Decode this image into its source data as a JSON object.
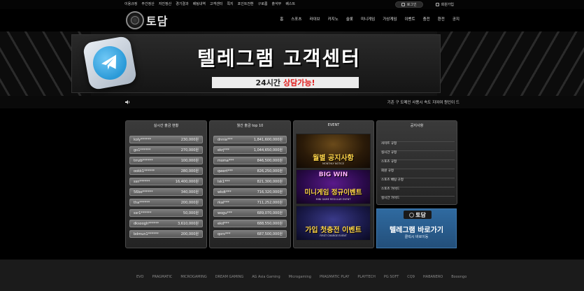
{
  "topbar": {
    "links": [
      "이용규정",
      "주간정산",
      "자진정산",
      "경기결과",
      "베팅내역",
      "고객센터",
      "쪽지",
      "포인트전환",
      "구로롬",
      "출석부",
      "퀘스트"
    ],
    "login_label": "로그인",
    "signup_label": "회원가입"
  },
  "header": {
    "logo_text": "토담",
    "nav": [
      "홈",
      "스포츠",
      "라이브",
      "카지노",
      "슬롯",
      "미니게임",
      "가상게임",
      "이벤트",
      "충전",
      "환전",
      "공지"
    ]
  },
  "banner": {
    "title": "텔레그램 고객센터",
    "sub_a": "24시간",
    "sub_b": "상담가능!"
  },
  "ticker": {
    "text": "기존 구 도메인 사용시 속도 지여여 원인이 드"
  },
  "withdraw_panel": {
    "title": "실시간 출금 현황",
    "rows": [
      {
        "user": "koly******",
        "amount": "230,000원"
      },
      {
        "user": "go1******",
        "amount": "270,000원"
      },
      {
        "user": "tmzb******",
        "amount": "100,000원"
      },
      {
        "user": "ookk1******",
        "amount": "280,000원"
      },
      {
        "user": "ssn******",
        "amount": "16,400,000원"
      },
      {
        "user": "56bo******",
        "amount": "340,000원"
      },
      {
        "user": "tha******",
        "amount": "200,000원"
      },
      {
        "user": "ssr1******",
        "amount": "50,000원"
      },
      {
        "user": "dksoogh******",
        "amount": "3,610,000원"
      },
      {
        "user": "bdmun1******",
        "amount": "200,000원"
      }
    ]
  },
  "top10_panel": {
    "title": "월간 출금 top 10",
    "rows": [
      {
        "user": "dnnia***",
        "amount": "1,841,600,000원"
      },
      {
        "user": "ekrj***",
        "amount": "1,044,650,000원"
      },
      {
        "user": "moma***",
        "amount": "846,500,000원"
      },
      {
        "user": "qwert***",
        "amount": "826,250,000원"
      },
      {
        "user": "lsk1***",
        "amount": "821,300,000원"
      },
      {
        "user": "wkdt***",
        "amount": "716,320,000원"
      },
      {
        "user": "rkal***",
        "amount": "711,252,000원"
      },
      {
        "user": "wogu***",
        "amount": "689,070,000원"
      },
      {
        "user": "ekd***",
        "amount": "688,550,000원"
      },
      {
        "user": "qors***",
        "amount": "687,500,000원"
      }
    ]
  },
  "event_panel": {
    "title": "EVENT",
    "events": [
      {
        "title": "월별 공지사항",
        "sub": "MONTHLY NOTICE"
      },
      {
        "title": "미니게임 정규이벤트",
        "sub": "MINI GAME REGULAR EVENT",
        "badge": "BIG WIN"
      },
      {
        "title": "가입 첫충전 이벤트",
        "sub": "FIRST CHARGE EVENT"
      }
    ]
  },
  "notice_panel": {
    "title": "공지사항",
    "items": [
      "사이트 규정",
      "실시간 규정",
      "스포츠 규정",
      "회원 규정",
      "스포츠 베팅 규정",
      "스포츠 가이드",
      "실시간 가이드"
    ]
  },
  "telegram_shortcut": {
    "logo": "토담",
    "title": "텔레그램 바로가기",
    "sub": "클릭시 바로이동"
  },
  "footer": {
    "partners": [
      "EVO",
      "PRAGMATIC",
      "MICROGAMING",
      "DREAM GAMING",
      "AG Asia Gaming",
      "Microgaming",
      "PRAGMATIC PLAY",
      "PLAYTECH",
      "PG SOFT",
      "CQ9",
      "HABANERO",
      "Booongo"
    ]
  },
  "colors": {
    "gold": "#ffd54a",
    "accent_red": "#e21d1d",
    "telegram_blue": "#2a9ad8"
  }
}
